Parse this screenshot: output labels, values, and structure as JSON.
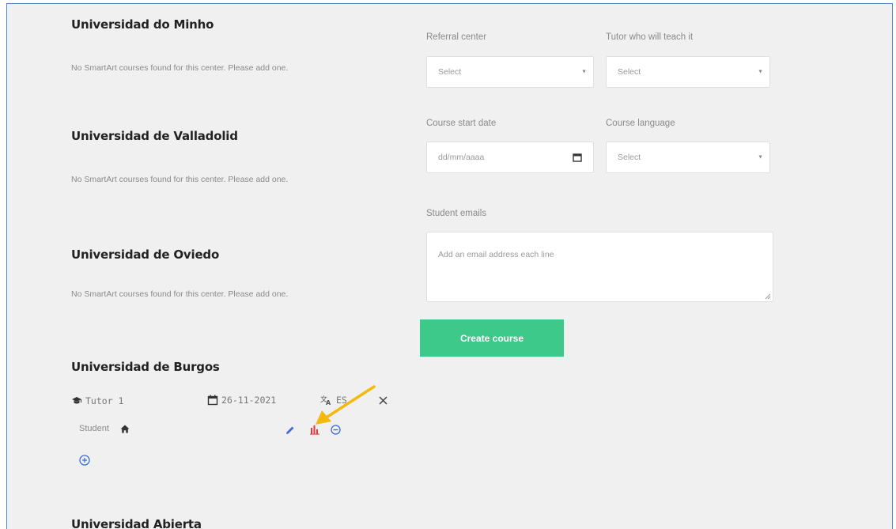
{
  "centers": [
    {
      "name": "Universidad do Minho",
      "message": "No SmartArt courses found for this center. Please add one."
    },
    {
      "name": "Universidad de Valladolid",
      "message": "No SmartArt courses found for this center. Please add one."
    },
    {
      "name": "Universidad de Oviedo",
      "message": "No SmartArt courses found for this center. Please add one."
    },
    {
      "name": "Universidad de Burgos"
    },
    {
      "name": "Universidad Abierta"
    }
  ],
  "course": {
    "tutor": "Tutor 1",
    "date": "26-11-2021",
    "language": "ES",
    "student_label": "Student"
  },
  "form": {
    "referral_label": "Referral center",
    "referral_value": "Select",
    "tutor_label": "Tutor who will teach it",
    "tutor_value": "Select",
    "start_date_label": "Course start date",
    "start_date_placeholder": "dd/mm/aaaa",
    "language_label": "Course language",
    "language_value": "Select",
    "emails_label": "Student emails",
    "emails_placeholder": "Add an email address each line",
    "create_button": "Create course"
  },
  "colors": {
    "accent_green": "#3cc98a",
    "icon_blue": "#3a6fd8",
    "icon_red": "#e23b3b",
    "annotation_arrow": "#f5b80c",
    "frame_border": "#4a86c8"
  },
  "icons": {
    "tutor": "graduation-cap-icon",
    "date": "calendar-icon",
    "language": "translate-icon",
    "delete": "close-icon",
    "student_home": "home-icon",
    "edit": "pencil-icon",
    "stats": "bar-chart-icon",
    "remove": "minus-circle-icon",
    "add": "plus-circle-icon"
  }
}
